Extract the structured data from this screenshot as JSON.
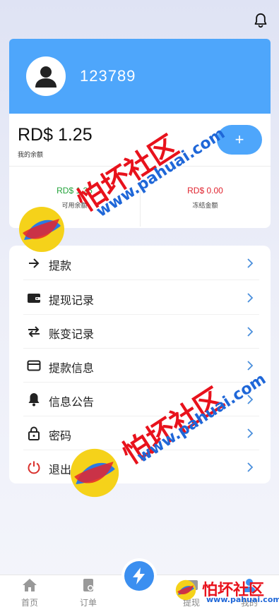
{
  "profile": {
    "user_id": "123789"
  },
  "balance": {
    "amount": "RD$ 1.25",
    "label": "我的余额",
    "add_label": "+",
    "available": {
      "amount": "RD$ 1.25",
      "label": "可用余额"
    },
    "frozen": {
      "amount": "RD$ 0.00",
      "label": "冻结金额"
    }
  },
  "menu": {
    "items": [
      {
        "label": "提款",
        "icon": "withdraw-icon"
      },
      {
        "label": "提现记录",
        "icon": "wallet-icon"
      },
      {
        "label": "账变记录",
        "icon": "exchange-icon"
      },
      {
        "label": "提款信息",
        "icon": "card-icon"
      },
      {
        "label": "信息公告",
        "icon": "bell-icon"
      },
      {
        "label": "密码",
        "icon": "lock-icon"
      },
      {
        "label": "退出",
        "icon": "power-icon"
      }
    ]
  },
  "tabbar": {
    "tabs": [
      {
        "label": "首页",
        "icon": "home-icon"
      },
      {
        "label": "订单",
        "icon": "order-icon"
      },
      {
        "label": "提现",
        "icon": "withdraw-tab-icon"
      },
      {
        "label": "我的",
        "icon": "user-icon"
      }
    ],
    "center_icon": "lightning-icon"
  },
  "watermark": {
    "text": "怕坏社区",
    "url": "www.pahuai.com"
  },
  "colors": {
    "accent": "#4ea6fb",
    "green": "#22a33a",
    "red": "#e0232e"
  }
}
